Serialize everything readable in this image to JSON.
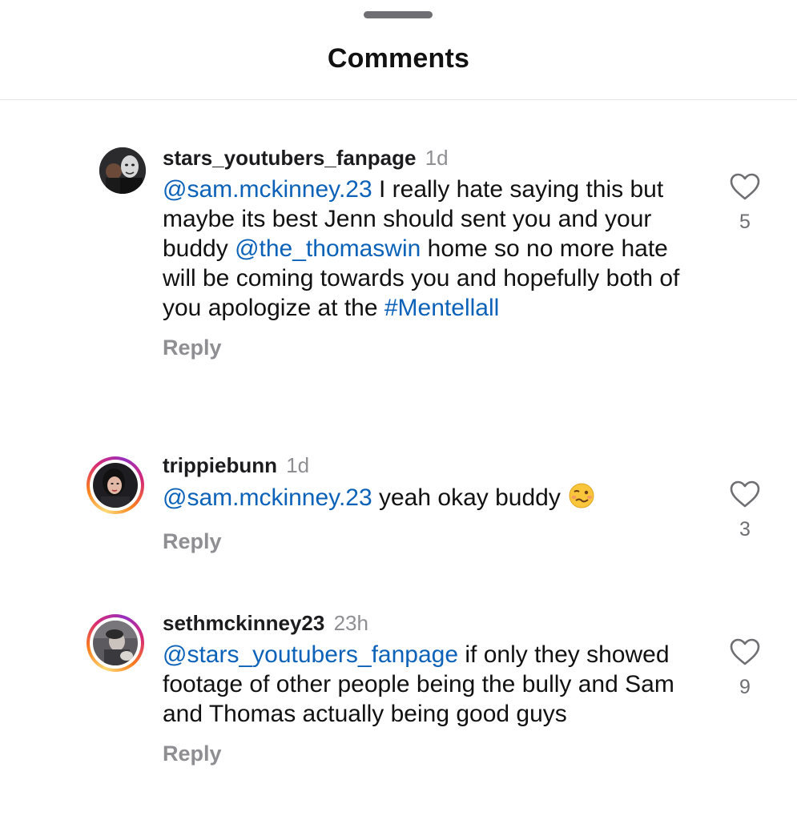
{
  "header": {
    "title": "Comments"
  },
  "comments": [
    {
      "username": "stars_youtubers_fanpage",
      "time": "1d",
      "segments": [
        {
          "type": "mention",
          "text": "@sam.mckinney.23"
        },
        {
          "type": "text",
          "text": " I really hate saying this but maybe its best Jenn should sent you and your buddy "
        },
        {
          "type": "mention",
          "text": "@the_thomaswin"
        },
        {
          "type": "text",
          "text": " home so no more hate will be coming towards you and hopefully both of you apologize at the "
        },
        {
          "type": "hashtag",
          "text": "#Mentellall"
        }
      ],
      "reply_label": "Reply",
      "like_count": "5",
      "has_story_ring": false
    },
    {
      "username": "trippiebunn",
      "time": "1d",
      "segments": [
        {
          "type": "mention",
          "text": "@sam.mckinney.23"
        },
        {
          "type": "text",
          "text": " yeah okay buddy"
        }
      ],
      "emoji": "woozy-face",
      "reply_label": "Reply",
      "like_count": "3",
      "has_story_ring": true
    },
    {
      "username": "sethmckinney23",
      "time": "23h",
      "segments": [
        {
          "type": "mention",
          "text": "@stars_youtubers_fanpage"
        },
        {
          "type": "text",
          "text": " if only they showed footage of other people being the bully and Sam and Thomas actually being good guys"
        }
      ],
      "reply_label": "Reply",
      "like_count": "9",
      "has_story_ring": true
    }
  ],
  "colors": {
    "mention": "#0b62b8",
    "secondary_text": "#8e8e93",
    "primary_text": "#111111"
  }
}
